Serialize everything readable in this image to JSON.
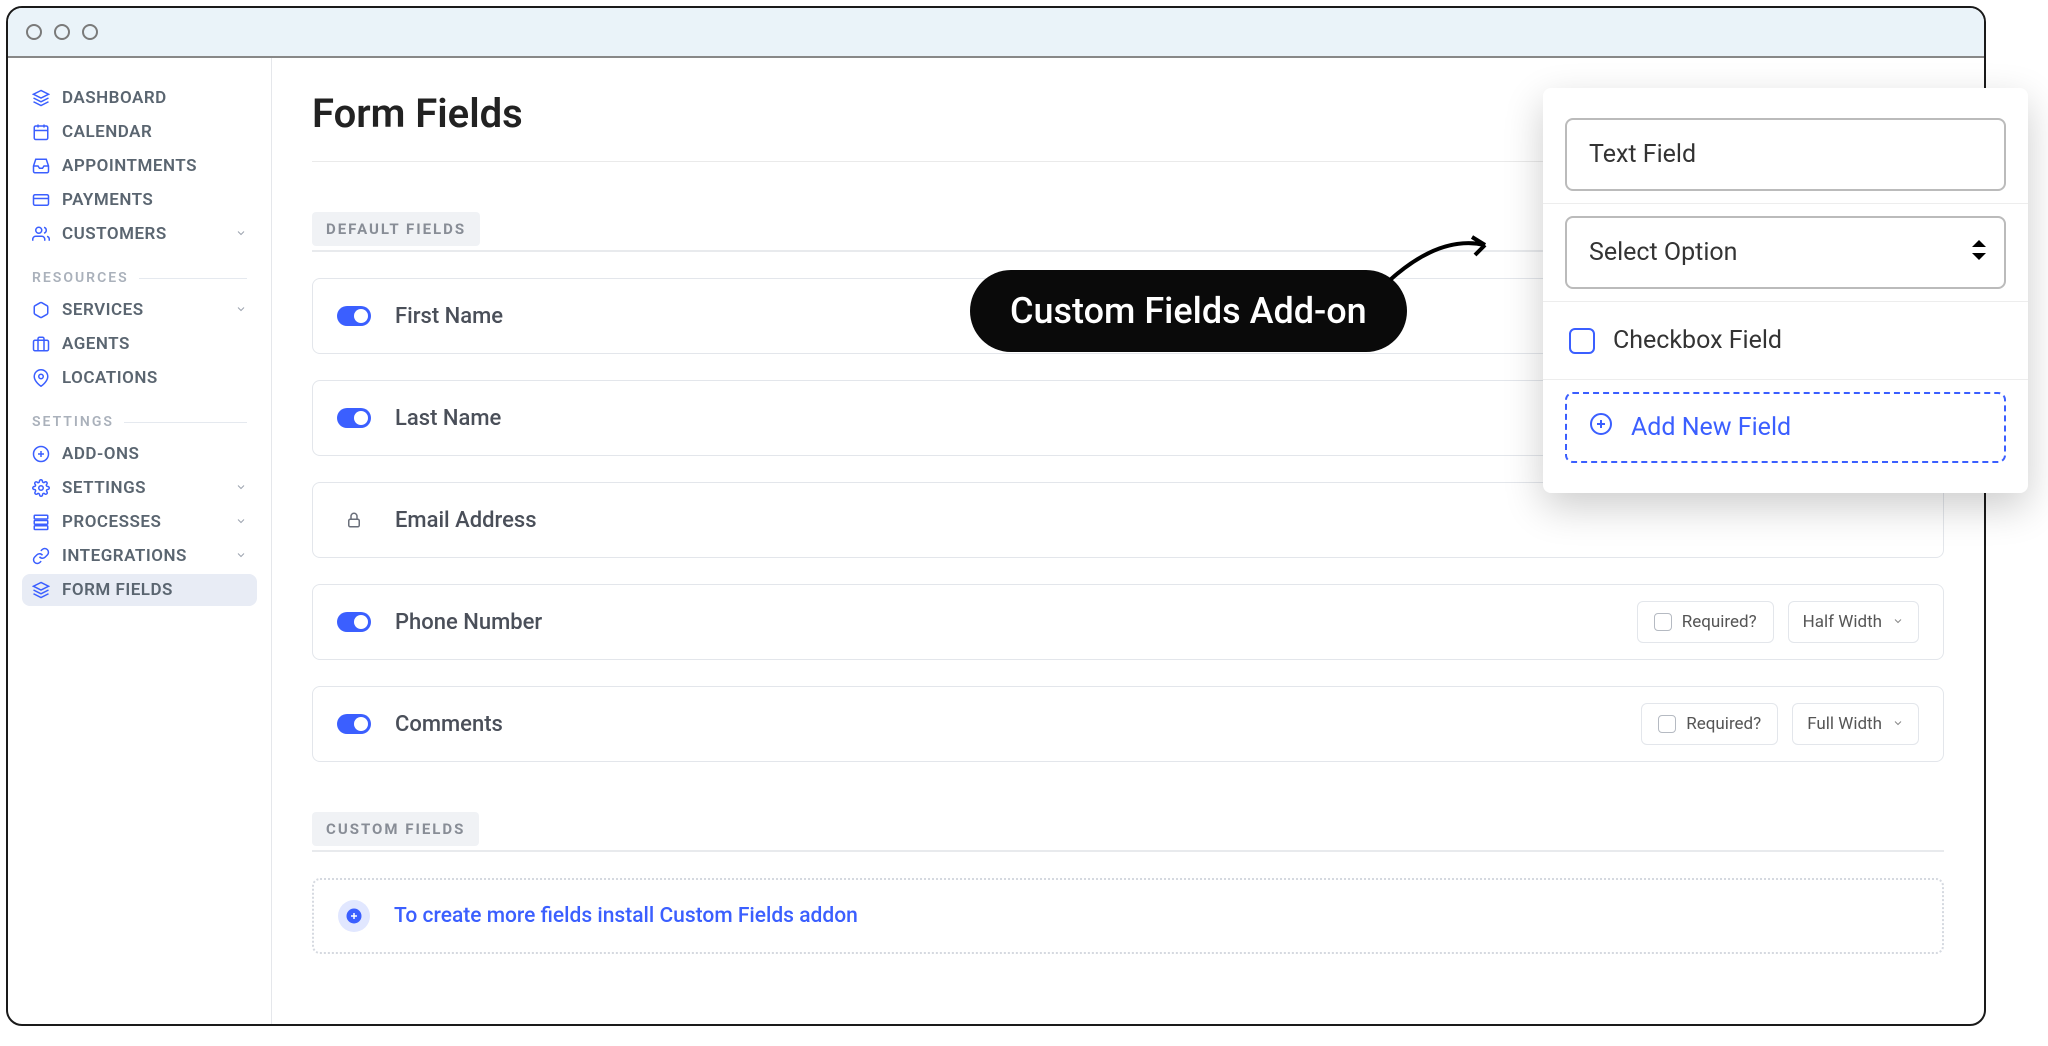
{
  "sidebar": {
    "items_main": [
      {
        "icon": "cube",
        "label": "DASHBOARD"
      },
      {
        "icon": "calendar",
        "label": "CALENDAR"
      },
      {
        "icon": "inbox",
        "label": "APPOINTMENTS"
      },
      {
        "icon": "card",
        "label": "PAYMENTS"
      },
      {
        "icon": "users",
        "label": "CUSTOMERS",
        "has_chevron": true
      }
    ],
    "resources_label": "RESOURCES",
    "items_resources": [
      {
        "icon": "cube",
        "label": "SERVICES",
        "has_chevron": true
      },
      {
        "icon": "briefcase",
        "label": "AGENTS"
      },
      {
        "icon": "pin",
        "label": "LOCATIONS"
      }
    ],
    "settings_label": "SETTINGS",
    "items_settings": [
      {
        "icon": "plus",
        "label": "ADD-ONS"
      },
      {
        "icon": "gear",
        "label": "SETTINGS",
        "has_chevron": true
      },
      {
        "icon": "stack",
        "label": "PROCESSES",
        "has_chevron": true
      },
      {
        "icon": "link",
        "label": "INTEGRATIONS",
        "has_chevron": true
      },
      {
        "icon": "layers",
        "label": "FORM FIELDS",
        "active": true
      }
    ]
  },
  "page": {
    "title": "Form Fields",
    "default_fields_label": "DEFAULT FIELDS",
    "custom_fields_label": "CUSTOM FIELDS",
    "fields": [
      {
        "toggle": true,
        "label": "First Name"
      },
      {
        "toggle": true,
        "label": "Last Name"
      },
      {
        "locked": true,
        "label": "Email Address"
      },
      {
        "toggle": true,
        "label": "Phone Number",
        "required_label": "Required?",
        "width_label": "Half Width"
      },
      {
        "toggle": true,
        "label": "Comments",
        "required_label": "Required?",
        "width_label": "Full Width"
      }
    ],
    "custom_row_text": "To create more fields install Custom Fields addon"
  },
  "callout": {
    "text": "Custom Fields Add-on"
  },
  "popover": {
    "text_field": "Text Field",
    "select_option": "Select Option",
    "checkbox_field": "Checkbox Field",
    "add_new_field": "Add New Field"
  }
}
